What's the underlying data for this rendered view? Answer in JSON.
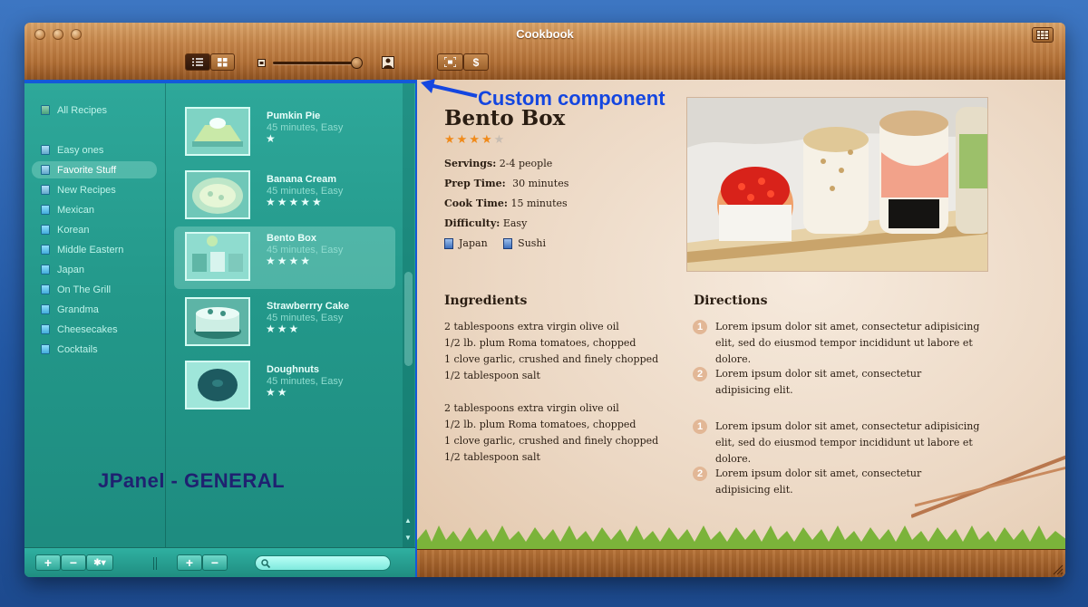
{
  "window": {
    "title": "Cookbook"
  },
  "toolbar": {
    "view_list_icon": "list-view-icon",
    "view_grid_icon": "grid-view-icon",
    "slider_value": 0.9,
    "fullscreen_icon": "fullscreen-icon",
    "price_label": "$"
  },
  "sidebar": {
    "items": [
      {
        "label": "All Recipes",
        "icon": "book-icon",
        "selected": false
      },
      {
        "label": "Easy ones",
        "icon": "smart-folder-icon",
        "selected": false
      },
      {
        "label": "Favorite Stuff",
        "icon": "smart-folder-icon",
        "selected": true
      },
      {
        "label": "New Recipes",
        "icon": "smart-folder-icon",
        "selected": false
      },
      {
        "label": "Mexican",
        "icon": "folder-icon",
        "selected": false
      },
      {
        "label": "Korean",
        "icon": "folder-icon",
        "selected": false
      },
      {
        "label": "Middle Eastern",
        "icon": "folder-icon",
        "selected": false
      },
      {
        "label": "Japan",
        "icon": "folder-icon",
        "selected": false
      },
      {
        "label": "On The Grill",
        "icon": "folder-icon",
        "selected": false
      },
      {
        "label": "Grandma",
        "icon": "folder-icon",
        "selected": false
      },
      {
        "label": "Cheesecakes",
        "icon": "folder-icon",
        "selected": false
      },
      {
        "label": "Cocktails",
        "icon": "folder-icon",
        "selected": false
      }
    ]
  },
  "recipes": [
    {
      "name": "Pumkin Pie",
      "meta": "45 minutes, Easy",
      "stars": "★",
      "rating": 1,
      "selected": false
    },
    {
      "name": "Banana Cream",
      "meta": "45 minutes, Easy",
      "stars": "★★★★★",
      "rating": 5,
      "selected": false
    },
    {
      "name": "Bento Box",
      "meta": "45 minutes, Easy",
      "stars": "★★★★",
      "rating": 4,
      "selected": true
    },
    {
      "name": "Strawberrry Cake",
      "meta": "45 minutes, Easy",
      "stars": "★★★",
      "rating": 3,
      "selected": false
    },
    {
      "name": "Doughnuts",
      "meta": "45 minutes, Easy",
      "stars": "★★",
      "rating": 2,
      "selected": false
    }
  ],
  "bottom": {
    "add": "+",
    "remove": "−",
    "action": "✱▾"
  },
  "detail": {
    "title": "Bento Box",
    "rating": 4,
    "rating_max": 5,
    "servings_label": "Servings:",
    "servings": "2-4 people",
    "prep_label": "Prep Time:",
    "prep": "30 minutes",
    "cook_label": "Cook Time:",
    "cook": "15 minutes",
    "difficulty_label": "Difficulty:",
    "difficulty": "Easy",
    "tags": [
      "Japan",
      "Sushi"
    ],
    "ingredients_title": "Ingredients",
    "directions_title": "Directions",
    "ingredients_a": [
      "2 tablespoons extra virgin olive oil",
      "1/2 lb. plum Roma tomatoes, chopped",
      "1 clove garlic, crushed and finely chopped",
      "1/2 tablespoon salt"
    ],
    "ingredients_b": [
      "2 tablespoons extra virgin olive oil",
      "1/2 lb. plum Roma tomatoes, chopped",
      "1 clove garlic, crushed and finely chopped",
      "1/2 tablespoon salt"
    ],
    "steps": [
      {
        "num": "1",
        "text": "Lorem ipsum dolor sit amet, consectetur adipisicing elit, sed do eiusmod tempor incididunt ut labore et dolore."
      },
      {
        "num": "2",
        "text": "Lorem ipsum dolor sit amet, consectetur adipisicing elit."
      },
      {
        "num": "1",
        "text": "Lorem ipsum dolor sit amet, consectetur adipisicing elit, sed do eiusmod tempor incididunt ut labore et dolore."
      },
      {
        "num": "2",
        "text": "Lorem ipsum dolor sit amet, consectetur adipisicing elit."
      }
    ]
  },
  "annotations": {
    "left": "JPanel - GENERAL",
    "right": "Custom component"
  },
  "colors": {
    "accent_blue": "#1459d8",
    "teal": "#23988a",
    "star_orange": "#f08a1a"
  }
}
